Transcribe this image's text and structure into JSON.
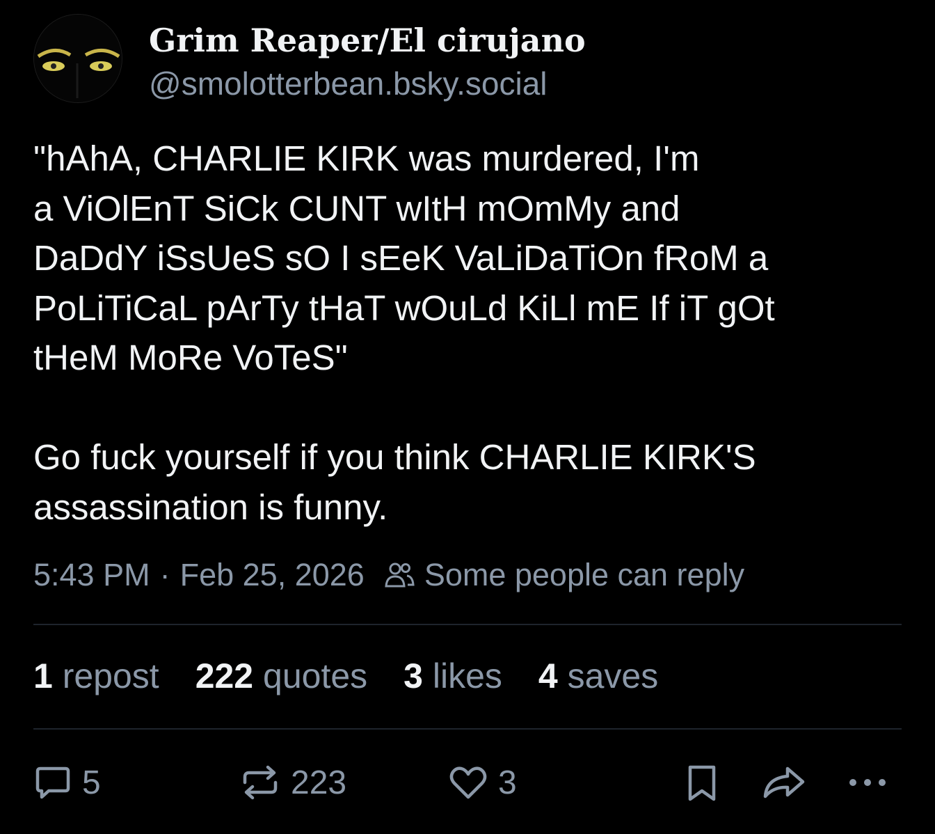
{
  "author": {
    "display_name": "Grim Reaper/El cirujano",
    "handle": "@smolotterbean.bsky.social"
  },
  "post": {
    "text": "\"hAhA, CHARLIE KIRK was murdered, I'm\na ViOlEnT SiCk CUNT wItH mOmMy and\nDaDdY iSsUeS sO I sEeK VaLiDaTiOn fRoM a\nPoLiTiCaL pArTy tHaT wOuLd KiLl mE If iT gOt\ntHeM MoRe VoTeS\"\n\nGo fuck yourself if you think CHARLIE KIRK'S\nassassination is funny.",
    "time": "5:43 PM",
    "date": "Feb 25, 2026",
    "separator": "·",
    "reply_setting": "Some people can reply"
  },
  "stats": {
    "reposts_count": "1",
    "reposts_label": "repost",
    "quotes_count": "222",
    "quotes_label": "quotes",
    "likes_count": "3",
    "likes_label": "likes",
    "saves_count": "4",
    "saves_label": "saves"
  },
  "actions": {
    "reply_count": "5",
    "repost_count": "223",
    "like_count": "3"
  },
  "icons": [
    "people-icon",
    "reply-icon",
    "repost-icon",
    "heart-icon",
    "bookmark-icon",
    "share-icon",
    "more-icon"
  ],
  "colors": {
    "background": "#000000",
    "text": "#f1f3f5",
    "muted": "#8b98a8",
    "divider": "#1e242c"
  }
}
